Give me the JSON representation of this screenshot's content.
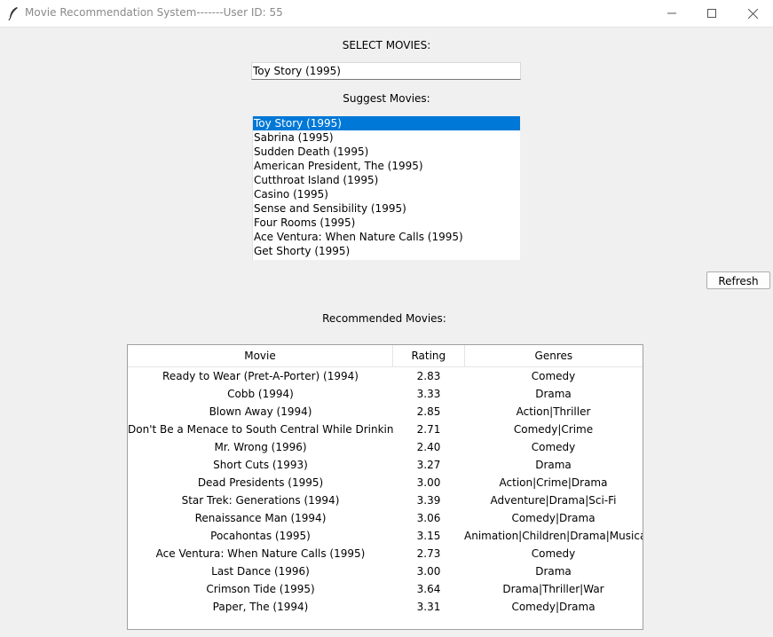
{
  "window": {
    "title": "Movie Recommendation System-------User ID: 55",
    "icon": "feather-icon"
  },
  "select_section": {
    "label": "SELECT MOVIES:",
    "input_value": "Toy Story (1995)"
  },
  "suggest_section": {
    "label": "Suggest Movies:",
    "items": [
      {
        "label": "Toy Story (1995)",
        "selected": true
      },
      {
        "label": "Sabrina (1995)"
      },
      {
        "label": "Sudden Death (1995)"
      },
      {
        "label": "American President, The (1995)"
      },
      {
        "label": "Cutthroat Island (1995)"
      },
      {
        "label": "Casino (1995)"
      },
      {
        "label": "Sense and Sensibility (1995)"
      },
      {
        "label": "Four Rooms (1995)"
      },
      {
        "label": "Ace Ventura: When Nature Calls (1995)"
      },
      {
        "label": "Get Shorty (1995)"
      }
    ]
  },
  "refresh_button": {
    "label": "Refresh"
  },
  "recommended_section": {
    "label": "Recommended Movies:",
    "columns": {
      "movie": "Movie",
      "rating": "Rating",
      "genres": "Genres"
    },
    "rows": [
      {
        "movie": "Ready to Wear (Pret-A-Porter) (1994)",
        "rating": "2.83",
        "genres": "Comedy"
      },
      {
        "movie": "Cobb (1994)",
        "rating": "3.33",
        "genres": "Drama"
      },
      {
        "movie": "Blown Away (1994)",
        "rating": "2.85",
        "genres": "Action|Thriller"
      },
      {
        "movie": "Don't Be a Menace to South Central While Drinking You",
        "rating": "2.71",
        "genres": "Comedy|Crime"
      },
      {
        "movie": "Mr. Wrong (1996)",
        "rating": "2.40",
        "genres": "Comedy"
      },
      {
        "movie": "Short Cuts (1993)",
        "rating": "3.27",
        "genres": "Drama"
      },
      {
        "movie": "Dead Presidents (1995)",
        "rating": "3.00",
        "genres": "Action|Crime|Drama"
      },
      {
        "movie": "Star Trek: Generations (1994)",
        "rating": "3.39",
        "genres": "Adventure|Drama|Sci-Fi"
      },
      {
        "movie": "Renaissance Man (1994)",
        "rating": "3.06",
        "genres": "Comedy|Drama"
      },
      {
        "movie": "Pocahontas (1995)",
        "rating": "3.15",
        "genres": "Animation|Children|Drama|Musical|R"
      },
      {
        "movie": "Ace Ventura: When Nature Calls (1995)",
        "rating": "2.73",
        "genres": "Comedy"
      },
      {
        "movie": "Last Dance (1996)",
        "rating": "3.00",
        "genres": "Drama"
      },
      {
        "movie": "Crimson Tide (1995)",
        "rating": "3.64",
        "genres": "Drama|Thriller|War"
      },
      {
        "movie": "Paper, The (1994)",
        "rating": "3.31",
        "genres": "Comedy|Drama"
      }
    ]
  },
  "colors": {
    "window_bg": "#f0f0f0",
    "selection": "#0078d7",
    "title_text": "#8a8a8a"
  }
}
